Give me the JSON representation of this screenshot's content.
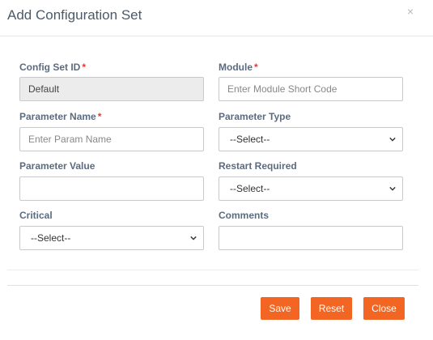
{
  "modal": {
    "title": "Add Configuration Set",
    "close_icon": "close-icon"
  },
  "form": {
    "config_set_id": {
      "label": "Config Set ID",
      "required_mark": "*",
      "value": "Default"
    },
    "module": {
      "label": "Module",
      "required_mark": "*",
      "placeholder": "Enter Module Short Code"
    },
    "parameter_name": {
      "label": "Parameter Name",
      "required_mark": "*",
      "placeholder": "Enter Param Name"
    },
    "parameter_type": {
      "label": "Parameter Type",
      "selected": "--Select--"
    },
    "parameter_value": {
      "label": "Parameter Value",
      "value": ""
    },
    "restart_required": {
      "label": "Restart Required",
      "selected": "--Select--"
    },
    "critical": {
      "label": "Critical",
      "selected": "--Select--"
    },
    "comments": {
      "label": "Comments",
      "value": ""
    }
  },
  "footer": {
    "save_label": "Save",
    "reset_label": "Reset",
    "close_label": "Close"
  },
  "colors": {
    "accent": "#f26522",
    "required": "#e03a3a",
    "label": "#5b6b80"
  }
}
